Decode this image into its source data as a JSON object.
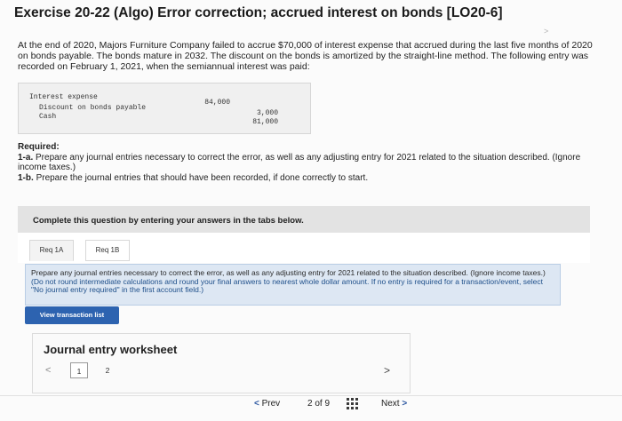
{
  "header": {
    "title": "Exercise 20-22 (Algo) Error correction; accrued interest on bonds [LO20-6]",
    "page_mark": ">"
  },
  "intro": {
    "text": "At the end of 2020, Majors Furniture Company failed to accrue $70,000 of interest expense that accrued during the last five months of 2020 on bonds payable. The bonds mature in 2032. The discount on the bonds is amortized by the straight-line method. The following entry was recorded on February 1, 2021, when the semiannual interest was paid:"
  },
  "journal_entry": {
    "lines": [
      {
        "account": "Interest expense",
        "debit": "84,000",
        "credit": ""
      },
      {
        "account": "Discount on bonds payable",
        "debit": "",
        "credit": "3,000"
      },
      {
        "account": "Cash",
        "debit": "",
        "credit": "81,000"
      }
    ]
  },
  "required": {
    "heading": "Required:",
    "item_1a_label": "1-a.",
    "item_1a_text": "Prepare any journal entries necessary to correct the error, as well as any adjusting entry for 2021 related to the situation described. (Ignore income taxes.)",
    "item_1b_label": "1-b.",
    "item_1b_text": "Prepare the journal entries that should have been recorded, if done correctly to start."
  },
  "complete_bar": {
    "text": "Complete this question by entering your answers in the tabs below."
  },
  "tabs": [
    {
      "label": "Req 1A",
      "active": true
    },
    {
      "label": "Req 1B",
      "active": false
    }
  ],
  "instructions": {
    "main": "Prepare any journal entries necessary to correct the error, as well as any adjusting entry for 2021 related to the situation described. (Ignore income taxes.)",
    "note": "(Do not round intermediate calculations and round your final answers to nearest whole dollar amount. If no entry is required for a transaction/event, select \"No journal entry required\" in the first account field.)"
  },
  "view_transaction_list": {
    "label": "View transaction list"
  },
  "worksheet": {
    "title": "Journal entry worksheet",
    "prev_glyph": "<",
    "pages": [
      "1",
      "2"
    ],
    "next_glyph": ">"
  },
  "pager": {
    "prev_label": "Prev",
    "count_label": "2 of 9",
    "next_label": "Next",
    "prev_glyph": "<",
    "next_glyph": ">"
  }
}
